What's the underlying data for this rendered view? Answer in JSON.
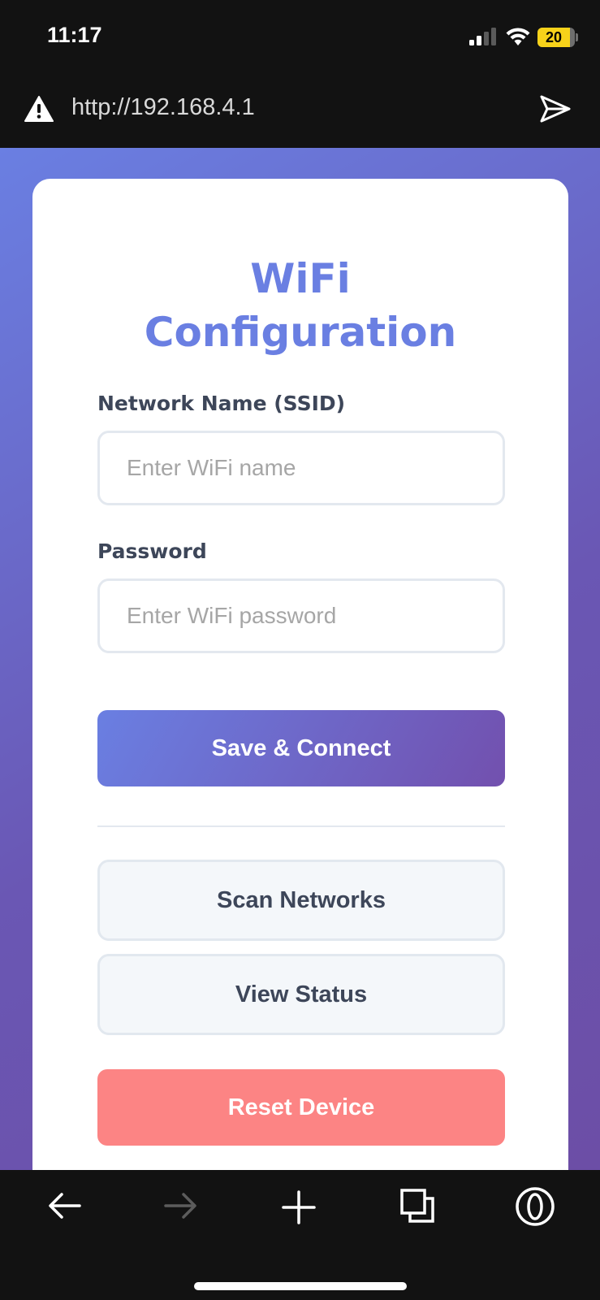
{
  "status_bar": {
    "time": "11:17",
    "battery_level": "20",
    "battery_color": "#f7d21a",
    "icons": [
      "signal-icon",
      "wifi-icon",
      "battery-icon"
    ]
  },
  "browser": {
    "url": "http://192.168.4.1",
    "icons": [
      "warning-icon",
      "send-icon"
    ]
  },
  "form": {
    "title": "WiFi Configuration",
    "ssid_label": "Network Name (SSID)",
    "ssid_placeholder": "Enter WiFi name",
    "ssid_value": "",
    "password_label": "Password",
    "password_placeholder": "Enter WiFi password",
    "password_value": "",
    "save_label": "Save & Connect",
    "scan_label": "Scan Networks",
    "status_label": "View Status",
    "reset_label": "Reset Device"
  },
  "colors": {
    "accent": "#6a7fe2",
    "gradient_end": "#7250ae",
    "danger": "#fc8484"
  },
  "bottom_nav": {
    "icons": [
      "back-arrow-icon",
      "forward-arrow-icon",
      "new-tab-plus-icon",
      "tabs-icon",
      "opera-menu-icon"
    ]
  }
}
